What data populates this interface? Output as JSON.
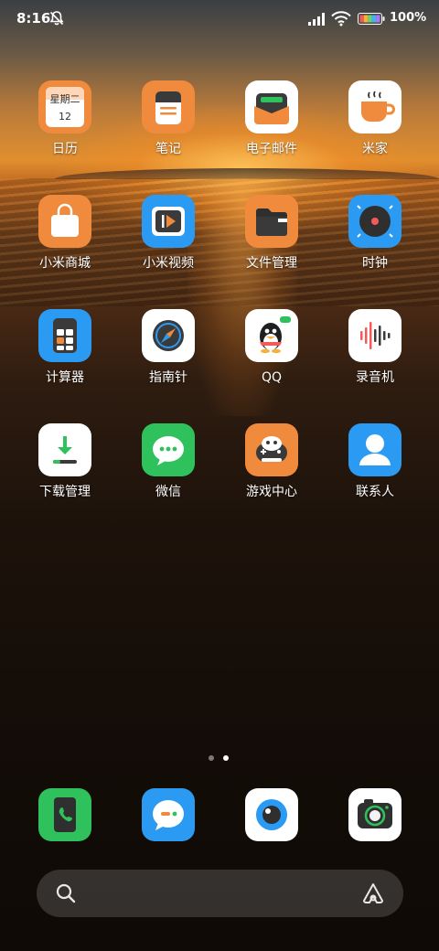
{
  "status_bar": {
    "time": "8:16",
    "battery": "100%",
    "icons": [
      "bell-off-icon",
      "signal-icon",
      "wifi-icon",
      "battery-icon"
    ]
  },
  "apps": [
    {
      "label": "日历",
      "icon": "calendar-icon",
      "bg": "#f08a3c",
      "weekday": "星期二",
      "day": "12"
    },
    {
      "label": "笔记",
      "icon": "notes-icon",
      "bg": "#f08a3c"
    },
    {
      "label": "电子邮件",
      "icon": "email-icon",
      "bg": "#ffffff"
    },
    {
      "label": "米家",
      "icon": "mijia-cup-icon",
      "bg": "#ffffff"
    },
    {
      "label": "小米商城",
      "icon": "shopping-bag-icon",
      "bg": "#f08a3c"
    },
    {
      "label": "小米视频",
      "icon": "video-play-icon",
      "bg": "#2b9af3"
    },
    {
      "label": "文件管理",
      "icon": "folder-icon",
      "bg": "#f08a3c"
    },
    {
      "label": "时钟",
      "icon": "clock-icon",
      "bg": "#2b9af3"
    },
    {
      "label": "计算器",
      "icon": "calculator-icon",
      "bg": "#2b9af3"
    },
    {
      "label": "指南针",
      "icon": "compass-icon",
      "bg": "#ffffff"
    },
    {
      "label": "QQ",
      "icon": "qq-penguin-icon",
      "bg": "#ffffff"
    },
    {
      "label": "录音机",
      "icon": "recorder-icon",
      "bg": "#ffffff"
    },
    {
      "label": "下载管理",
      "icon": "download-icon",
      "bg": "#ffffff"
    },
    {
      "label": "微信",
      "icon": "wechat-icon",
      "bg": "#2fc15b"
    },
    {
      "label": "游戏中心",
      "icon": "game-center-icon",
      "bg": "#f08a3c"
    },
    {
      "label": "联系人",
      "icon": "contacts-icon",
      "bg": "#2b9af3"
    }
  ],
  "dock": [
    {
      "name": "phone",
      "icon": "phone-icon",
      "bg": "#2fc15b"
    },
    {
      "name": "messages",
      "icon": "message-icon",
      "bg": "#2b9af3"
    },
    {
      "name": "browser",
      "icon": "browser-icon",
      "bg": "#ffffff"
    },
    {
      "name": "camera",
      "icon": "camera-icon",
      "bg": "#ffffff"
    }
  ],
  "page_indicator": {
    "pages": 2,
    "current": 2
  },
  "search": {
    "placeholder": "",
    "icons": [
      "search-icon",
      "voice-assistant-icon"
    ]
  },
  "colors": {
    "accent_orange": "#f08a3c",
    "accent_blue": "#2b9af3",
    "accent_green": "#2fc15b"
  }
}
